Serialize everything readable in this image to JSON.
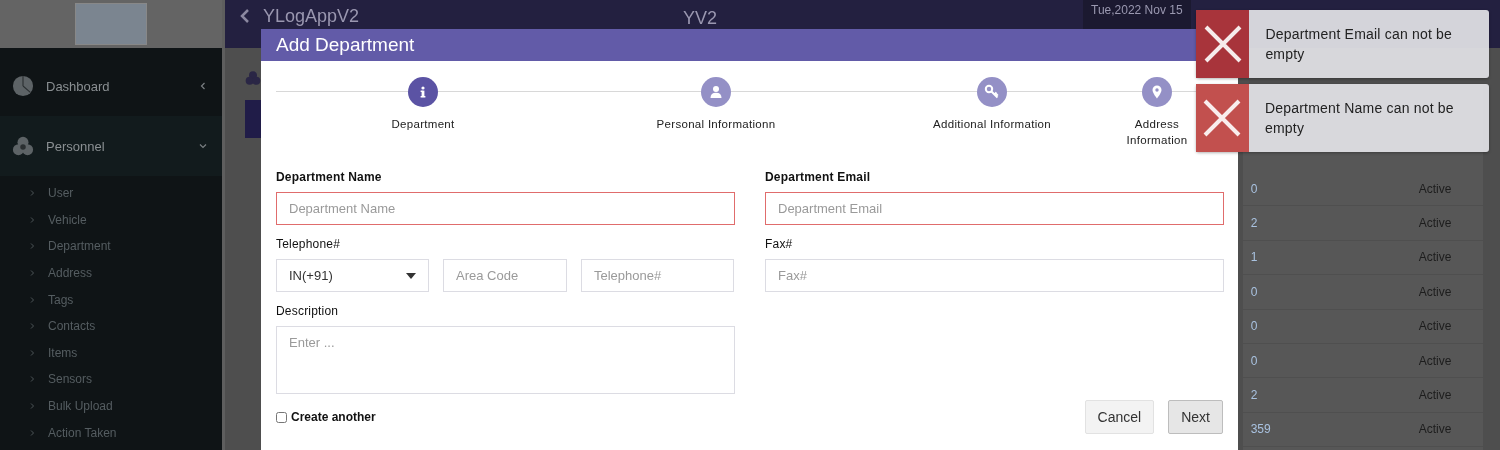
{
  "sidebar": {
    "menu": [
      {
        "label": "Dashboard",
        "kind": "pie",
        "expanded": false
      },
      {
        "label": "Personnel",
        "kind": "group",
        "expanded": true
      }
    ],
    "items": [
      "User",
      "Vehicle",
      "Department",
      "Address",
      "Tags",
      "Contacts",
      "Items",
      "Sensors",
      "Bulk Upload",
      "Action Taken"
    ]
  },
  "header": {
    "app_title": "YLogAppV2",
    "center_title": "YV2",
    "date": "Tue,2022 Nov 15"
  },
  "table": {
    "rows": [
      {
        "vehicles": "0",
        "status": "Active"
      },
      {
        "vehicles": "2",
        "status": "Active"
      },
      {
        "vehicles": "1",
        "status": "Active"
      },
      {
        "vehicles": "0",
        "status": "Active"
      },
      {
        "vehicles": "0",
        "status": "Active"
      },
      {
        "vehicles": "0",
        "status": "Active"
      },
      {
        "vehicles": "2",
        "status": "Active"
      },
      {
        "vehicles": "359",
        "status": "Active"
      }
    ]
  },
  "dialog": {
    "title": "Add Department",
    "steps": [
      {
        "label": "Department",
        "kind": "info",
        "selected": true
      },
      {
        "label": "Personal Informationn",
        "kind": "user",
        "selected": false
      },
      {
        "label": "Additional Information",
        "kind": "key",
        "selected": false
      },
      {
        "label": "Address Information",
        "kind": "pin",
        "selected": false
      }
    ],
    "department_name": {
      "label": "Department Name",
      "placeholder": "Department Name",
      "invalid": true
    },
    "department_email": {
      "label": "Department Email",
      "placeholder": "Department Email",
      "invalid": true
    },
    "telephone": {
      "label": "Telephone#",
      "country": "IN(+91)",
      "area_placeholder": "Area Code",
      "number_placeholder": "Telephone#"
    },
    "fax": {
      "label": "Fax#",
      "placeholder": "Fax#"
    },
    "description": {
      "label": "Description",
      "placeholder": "Enter ..."
    },
    "create_another": {
      "label": "Create another",
      "checked": false
    },
    "buttons": [
      "Cancel",
      "Next"
    ]
  },
  "toasts": [
    {
      "message": "Department Email can not be empty",
      "color": "#a8343b"
    },
    {
      "message": "Department Name can not be empty",
      "color": "#c2504e"
    }
  ]
}
